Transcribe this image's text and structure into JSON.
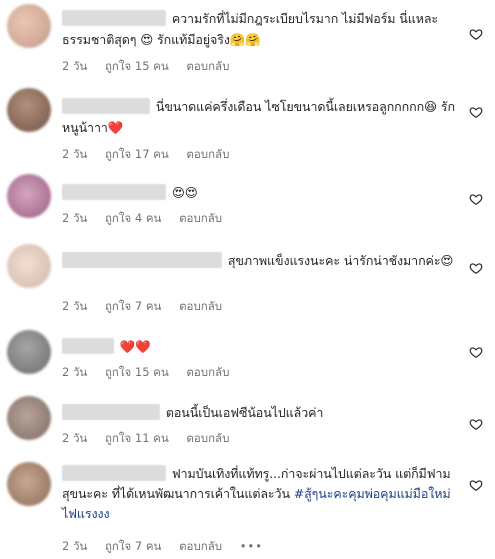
{
  "comments": [
    {
      "text": "ความรักที่ไม่มีกฎระเบียบไรมาก ไม่มีฟอร์ม นี่แหละธรรมชาติสุดๆ 😍 รักแท้มีอยู่จริง🤗🤗",
      "time": "2 วัน",
      "likes": "ถูกใจ 15 คน",
      "reply": "ตอบกลับ"
    },
    {
      "text": "นี่ขนาดแค่ครึ่งเดือน ไซโยขนาดนี้เลยเหรอลูกกกกก😆 รักหนูน้าาา❤️",
      "time": "2 วัน",
      "likes": "ถูกใจ 17 คน",
      "reply": "ตอบกลับ"
    },
    {
      "text": "😍😍",
      "time": "2 วัน",
      "likes": "ถูกใจ 4 คน",
      "reply": "ตอบกลับ"
    },
    {
      "text": "สุขภาพแข็งแรงนะคะ น่ารักน่าชังมากค่ะ😍",
      "time": "2 วัน",
      "likes": "ถูกใจ 7 คน",
      "reply": "ตอบกลับ"
    },
    {
      "text": "❤️❤️",
      "time": "2 วัน",
      "likes": "ถูกใจ 15 คน",
      "reply": "ตอบกลับ"
    },
    {
      "text": "ตอนนี้เป็นเอฟซีน้อนไปแล้วค่า",
      "time": "2 วัน",
      "likes": "ถูกใจ 11 คน",
      "reply": "ตอบกลับ"
    },
    {
      "text": "ฟามบันเทิงที่แท้ทรู...ก่าจะผ่านไปแต่ละวัน แต่ก็มีฟามสุขนะคะ ที่ได้เหนพัฒนาการเค้าในแต่ละวัน ",
      "hashtag": "#สู้ๆนะคะคุมพ่อคุมแม่มือใหม่ไฟแรงงง",
      "time": "2 วัน",
      "likes": "ถูกใจ 7 คน",
      "reply": "ตอบกลับ",
      "more": "•••"
    }
  ]
}
